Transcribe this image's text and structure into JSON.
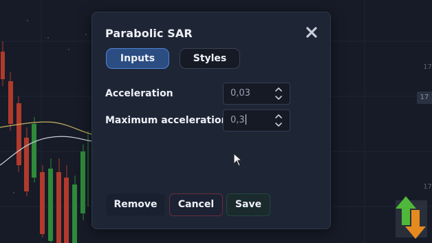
{
  "dialog": {
    "title": "Parabolic SAR",
    "tabs": [
      {
        "label": "Inputs",
        "active": true
      },
      {
        "label": "Styles",
        "active": false
      }
    ],
    "fields": [
      {
        "label": "Acceleration",
        "value": "0,03"
      },
      {
        "label": "Maximum acceleration",
        "value": "0,3"
      }
    ],
    "buttons": {
      "remove": "Remove",
      "cancel": "Cancel",
      "save": "Save"
    },
    "close_icon": "close-icon"
  },
  "background_chart": {
    "price_badge": "17",
    "right_tick_top": "17",
    "right_tick_bottom": "17"
  },
  "colors": {
    "active_tab": "#2b4d82",
    "active_tab_border": "#4f86d6",
    "cancel_border": "#6b2d38",
    "save_border": "#234840",
    "bullish_candle": "#2f8a3a",
    "bearish_candle": "#b23a2c"
  }
}
